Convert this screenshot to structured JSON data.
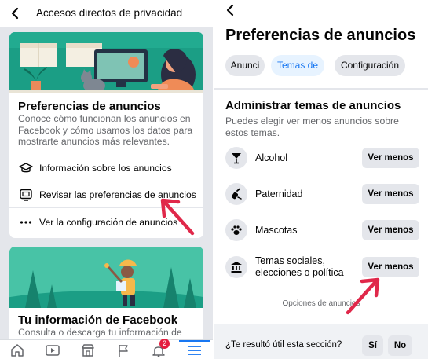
{
  "left": {
    "header": {
      "title": "Accesos directos de privacidad",
      "back_icon": "chevron-left-icon"
    },
    "card1": {
      "title": "Preferencias de anuncios",
      "description": "Conoce cómo funcionan los anuncios en Facebook y cómo usamos los datos para mostrarte anuncios más relevantes.",
      "options": [
        {
          "label": "Información sobre los anuncios",
          "icon": "graduation-cap-icon"
        },
        {
          "label": "Revisar las preferencias de anuncios",
          "icon": "screen-icon"
        },
        {
          "label": "Ver la configuración de anuncios",
          "icon": "more-dots-icon"
        }
      ]
    },
    "card2": {
      "title": "Tu información de Facebook",
      "description": "Consulta o descarga tu información de"
    },
    "tabbar": {
      "tabs": [
        "home-icon",
        "watch-icon",
        "marketplace-icon",
        "flag-icon",
        "notifications-icon",
        "menu-icon"
      ],
      "notification_count": "2"
    }
  },
  "right": {
    "back_icon": "chevron-left-icon",
    "page_title": "Preferencias de anuncios",
    "chips": [
      {
        "label": "Anunci",
        "active": false
      },
      {
        "label": "Temas de",
        "active": true
      },
      {
        "label": "Configuración",
        "active": false
      }
    ],
    "section": {
      "title": "Administrar temas de anuncios",
      "description": "Puedes elegir ver menos anuncios sobre estos temas."
    },
    "topics": [
      {
        "label": "Alcohol",
        "icon": "cocktail-icon",
        "button": "Ver menos"
      },
      {
        "label": "Paternidad",
        "icon": "baby-bottle-icon",
        "button": "Ver menos"
      },
      {
        "label": "Mascotas",
        "icon": "paw-icon",
        "button": "Ver menos"
      },
      {
        "label_line1": "Temas sociales,",
        "label_line2": "elecciones o política",
        "icon": "government-building-icon",
        "button": "Ver menos"
      }
    ],
    "more_link": "Opciones de anuncios",
    "footer": {
      "question": "¿Te resultó útil esta sección?",
      "yes": "Sí",
      "no": "No"
    }
  },
  "colors": {
    "accent": "#1877f2",
    "annotation_arrow": "#e0284a",
    "illustration_teal": "#1b9e85",
    "badge": "#e41e3f"
  }
}
